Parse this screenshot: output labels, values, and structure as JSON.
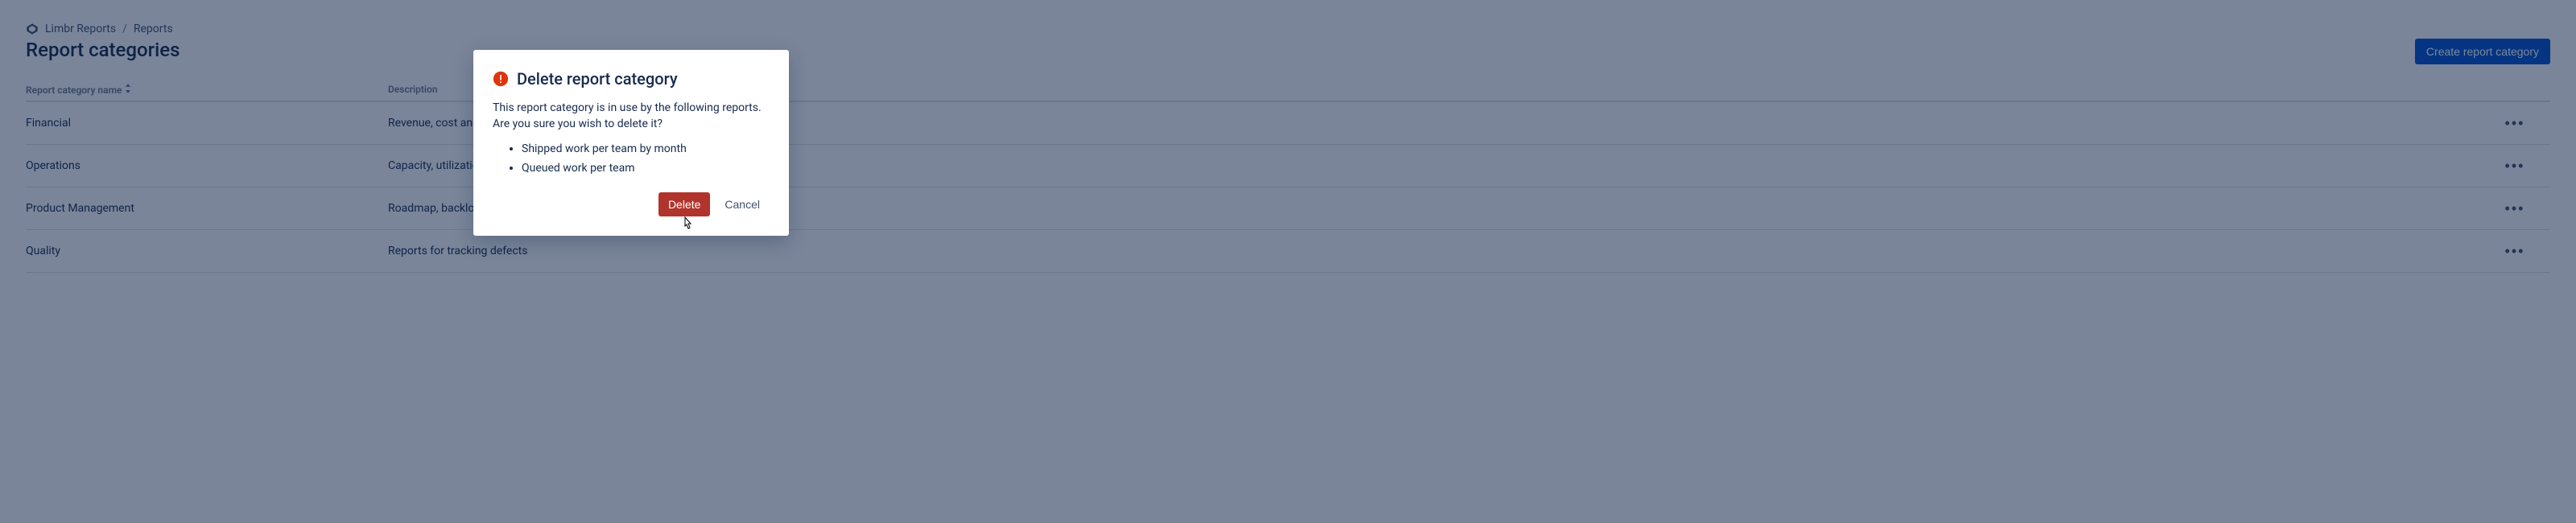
{
  "breadcrumb": {
    "app": "Limbr Reports",
    "section": "Reports"
  },
  "page_title": "Report categories",
  "create_button": "Create report category",
  "table": {
    "headers": {
      "name": "Report category name",
      "description": "Description"
    },
    "rows": [
      {
        "name": "Financial",
        "description": "Revenue, cost and profitability tracking"
      },
      {
        "name": "Operations",
        "description": "Capacity, utilization and throughput"
      },
      {
        "name": "Product Management",
        "description": "Roadmap, backlog and delivery status"
      },
      {
        "name": "Quality",
        "description": "Reports for tracking defects"
      }
    ]
  },
  "modal": {
    "title": "Delete report category",
    "body": "This report category is in use by the following reports. Are you sure you wish to delete it?",
    "items": [
      "Shipped work per team by month",
      "Queued work per team"
    ],
    "confirm": "Delete",
    "cancel": "Cancel"
  }
}
